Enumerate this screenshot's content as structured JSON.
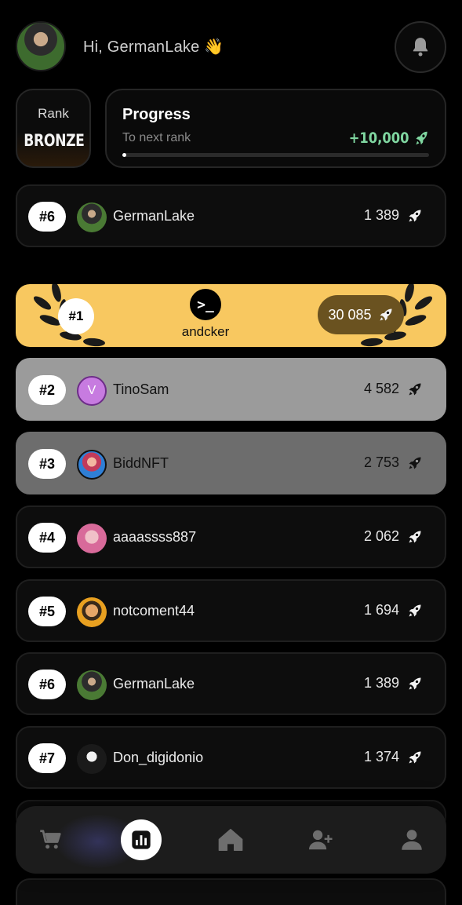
{
  "header": {
    "greeting": "Hi, GermanLake",
    "wave_emoji": "👋"
  },
  "rank": {
    "label": "Rank",
    "value": "BRONZE"
  },
  "progress": {
    "title": "Progress",
    "subtitle": "To next rank",
    "reward": "+10,000",
    "fraction": 0.01
  },
  "me": {
    "rank": "#6",
    "name": "GermanLake",
    "score": "1 389"
  },
  "first": {
    "rank": "#1",
    "name": "andcker",
    "score": "30 085"
  },
  "leaders": [
    {
      "rank": "#2",
      "name": "TinoSam",
      "score": "4 582",
      "initial": "V"
    },
    {
      "rank": "#3",
      "name": "BiddNFT",
      "score": "2 753"
    },
    {
      "rank": "#4",
      "name": "aaaassss887",
      "score": "2 062"
    },
    {
      "rank": "#5",
      "name": "notcoment44",
      "score": "1 694"
    },
    {
      "rank": "#6",
      "name": "GermanLake",
      "score": "1 389"
    },
    {
      "rank": "#7",
      "name": "Don_digidonio",
      "score": "1 374"
    }
  ],
  "nav": [
    "cart-icon",
    "leaderboard-icon",
    "home-icon",
    "add-friend-icon",
    "profile-icon"
  ],
  "colors": {
    "gold": "#f8c860",
    "silver": "#9b9b9b",
    "bronze": "#6d6d6d",
    "accent_green": "#7fd6a0"
  }
}
